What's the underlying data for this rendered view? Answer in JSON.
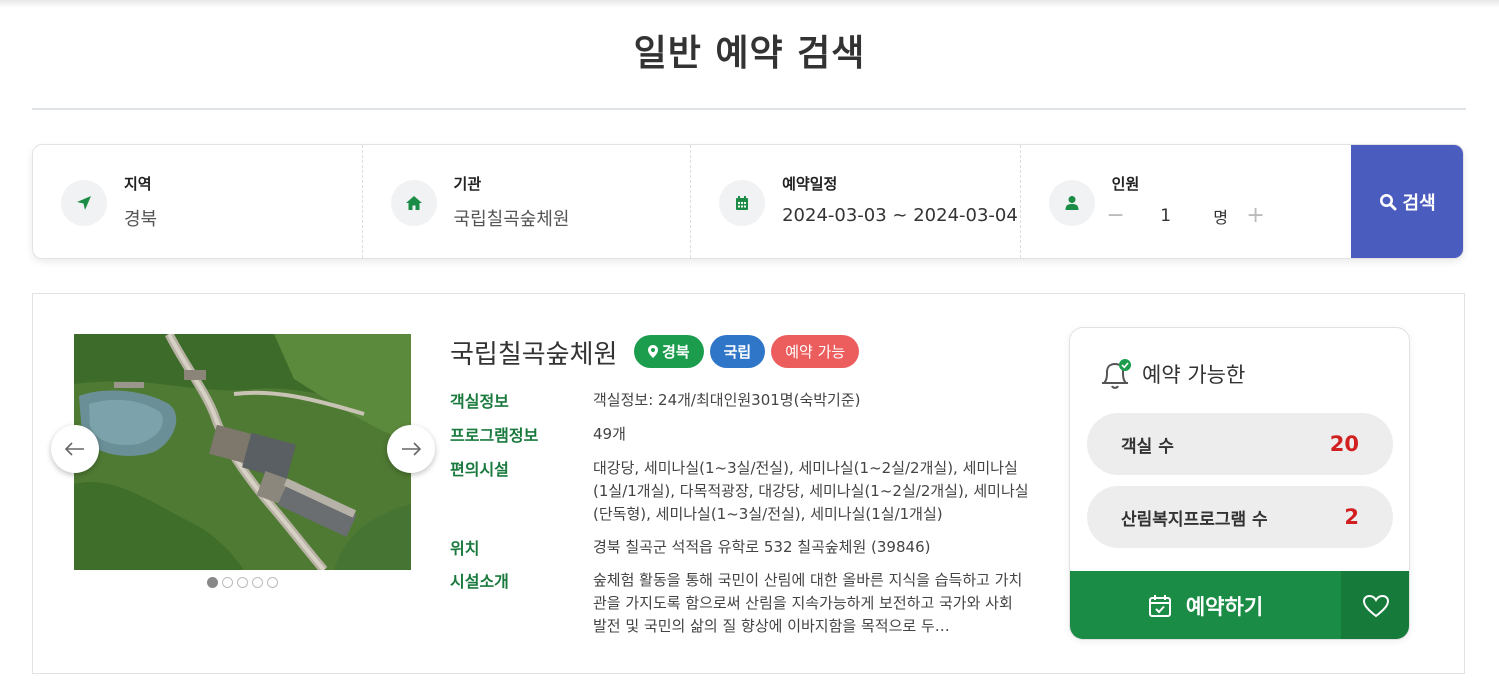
{
  "page": {
    "title": "일반 예약 검색"
  },
  "search": {
    "fields": [
      {
        "label": "지역",
        "value": "경북",
        "icon": "location-arrow-icon"
      },
      {
        "label": "기관",
        "value": "국립칠곡숲체원",
        "icon": "home-icon"
      },
      {
        "label": "예약일정",
        "value": "2024-03-03 ~ 2024-03-04",
        "icon": "calendar-icon"
      },
      {
        "label": "인원",
        "icon": "person-icon"
      }
    ],
    "people": {
      "minus": "−",
      "count": "1",
      "unit": "명",
      "plus": "+"
    },
    "button_label": "검색",
    "button_color": "#4a5cbe"
  },
  "result": {
    "name": "국립칠곡숲체원",
    "badges": {
      "region": "경북",
      "type": "국립",
      "status": "예약 가능"
    },
    "carousel": {
      "slides": 5,
      "active": 1
    },
    "info": [
      {
        "key": "객실정보",
        "value": "객실정보: 24개/최대인원301명(숙박기준)"
      },
      {
        "key": "프로그램정보",
        "value": "49개"
      },
      {
        "key": "편의시설",
        "value": "대강당, 세미나실(1~3실/전실), 세미나실(1~2실/2개실), 세미나실(1실/1개실), 다목적광장, 대강당, 세미나실(1~2실/2개실), 세미나실(단독형), 세미나실(1~3실/전실), 세미나실(1실/1개실)"
      },
      {
        "key": "위치",
        "value": "경북 칠곡군 석적읍 유학로 532 칠곡숲체원 (39846)"
      },
      {
        "key": "시설소개",
        "value": "숲체험 활동을 통해 국민이 산림에 대한 올바른 지식을 습득하고 가치관을 가지도록 함으로써 산림을 지속가능하게 보전하고 국가와 사회 발전 및 국민의 삶의 질 향상에 이바지함을 목적으로 두…"
      }
    ],
    "availability": {
      "title": "예약 가능한",
      "rooms_label": "객실 수",
      "rooms_count": "20",
      "programs_label": "산림복지프로그램 수",
      "programs_count": "2",
      "reserve_label": "예약하기"
    }
  },
  "colors": {
    "primary_green": "#1b8c45",
    "badge_region": "#1b9d4d",
    "badge_type": "#2f76c8",
    "badge_status": "#ec5e5e",
    "count_red": "#d21f1f"
  }
}
